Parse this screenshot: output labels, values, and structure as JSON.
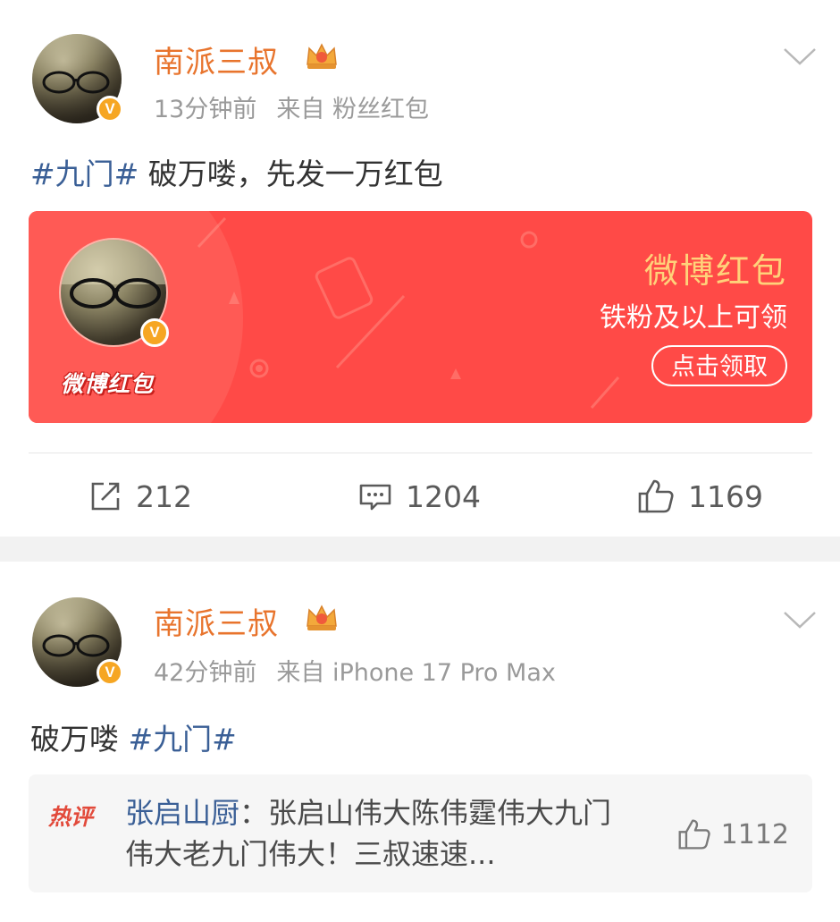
{
  "posts": [
    {
      "username": "南派三叔",
      "time": "13分钟前",
      "source": "来自 粉丝红包",
      "text_topic": "#九门#",
      "text_body": " 破万喽，先发一万红包",
      "red_packet": {
        "stamp": "微博红包",
        "title": "微博红包",
        "subtitle": "铁粉及以上可领",
        "button": "点击领取"
      },
      "actions": {
        "repost": "212",
        "comment": "1204",
        "like": "1169"
      }
    },
    {
      "username": "南派三叔",
      "time": "42分钟前",
      "source": "来自 iPhone 17 Pro Max",
      "text_body": "破万喽 ",
      "text_topic": "#九门#",
      "hot_comment": {
        "badge": "热评",
        "author": "张启山厨",
        "content": "：张启山伟大陈伟霆伟大九门伟大老九门伟大！三叔速速...",
        "likes": "1112"
      }
    }
  ],
  "icons": {
    "vip_badge": "v-badge-icon",
    "crown": "crown-icon",
    "menu": "chevron-down-icon",
    "repost": "repost-icon",
    "comment": "comment-icon",
    "like": "thumb-up-icon"
  },
  "colors": {
    "username": "#e8742d",
    "topic": "#3a5f96",
    "red_packet_bg": "#ff4a47",
    "red_packet_title": "#ffd27a"
  }
}
